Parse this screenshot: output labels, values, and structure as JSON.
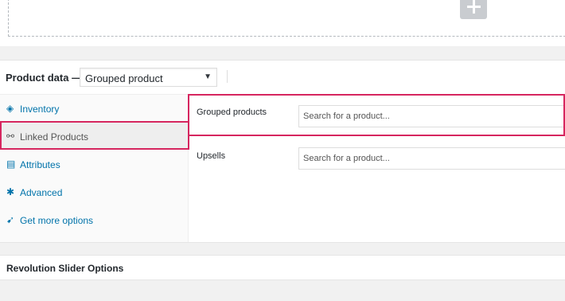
{
  "gallery": {
    "add_icon": "plus-icon"
  },
  "product_data": {
    "title": "Product data —",
    "type_selected": "Grouped product",
    "type_arrow": "▼"
  },
  "tabs": [
    {
      "label": "Inventory",
      "icon": "tag-icon",
      "glyph": "◈",
      "active": false
    },
    {
      "label": "Linked Products",
      "icon": "link-icon",
      "glyph": "⚯",
      "active": true
    },
    {
      "label": "Attributes",
      "icon": "table-icon",
      "glyph": "▤",
      "active": false
    },
    {
      "label": "Advanced",
      "icon": "gear-icon",
      "glyph": "✱",
      "active": false
    },
    {
      "label": "Get more options",
      "icon": "plugin-icon",
      "glyph": "➹",
      "active": false
    }
  ],
  "linked": {
    "grouped_label": "Grouped products",
    "grouped_placeholder": "Search for a product...",
    "upsells_label": "Upsells",
    "upsells_placeholder": "Search for a product..."
  },
  "revolution": {
    "title": "Revolution Slider Options"
  },
  "colors": {
    "highlight": "#d6265f",
    "link": "#0073aa"
  }
}
